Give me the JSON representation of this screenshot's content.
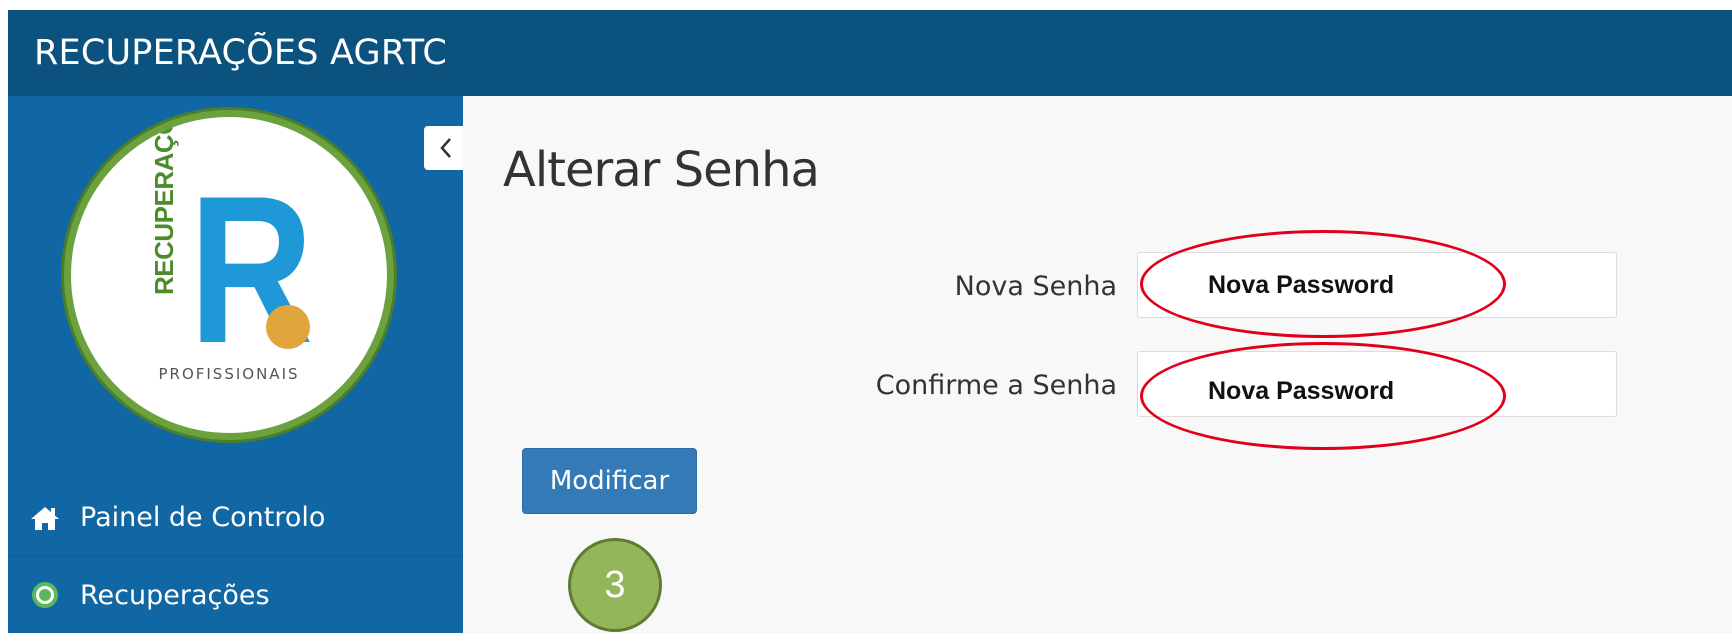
{
  "header": {
    "app_title": "RECUPERAÇÕES AGRTC"
  },
  "sidebar": {
    "collapse_icon": "chevron-left-icon",
    "logo": {
      "vertical_text": "RECUPERAÇÕES",
      "letter": "R",
      "subtitle": "PROFISSIONAIS"
    },
    "items": [
      {
        "label": "Painel de Controlo",
        "icon": "home-icon"
      },
      {
        "label": "Recuperações",
        "icon": "radio-dot-icon"
      }
    ]
  },
  "main": {
    "title": "Alterar Senha",
    "fields": [
      {
        "label": "Nova Senha",
        "value": "Nova Password"
      },
      {
        "label": "Confirme a Senha",
        "value": "Nova Password"
      }
    ],
    "submit_label": "Modificar",
    "step_badge": "3"
  },
  "colors": {
    "header_bg": "#0b527e",
    "sidebar_bg": "#1166a4",
    "button_bg": "#347ab7",
    "annotation_red": "#e0001b",
    "badge_green": "#94b65a"
  }
}
